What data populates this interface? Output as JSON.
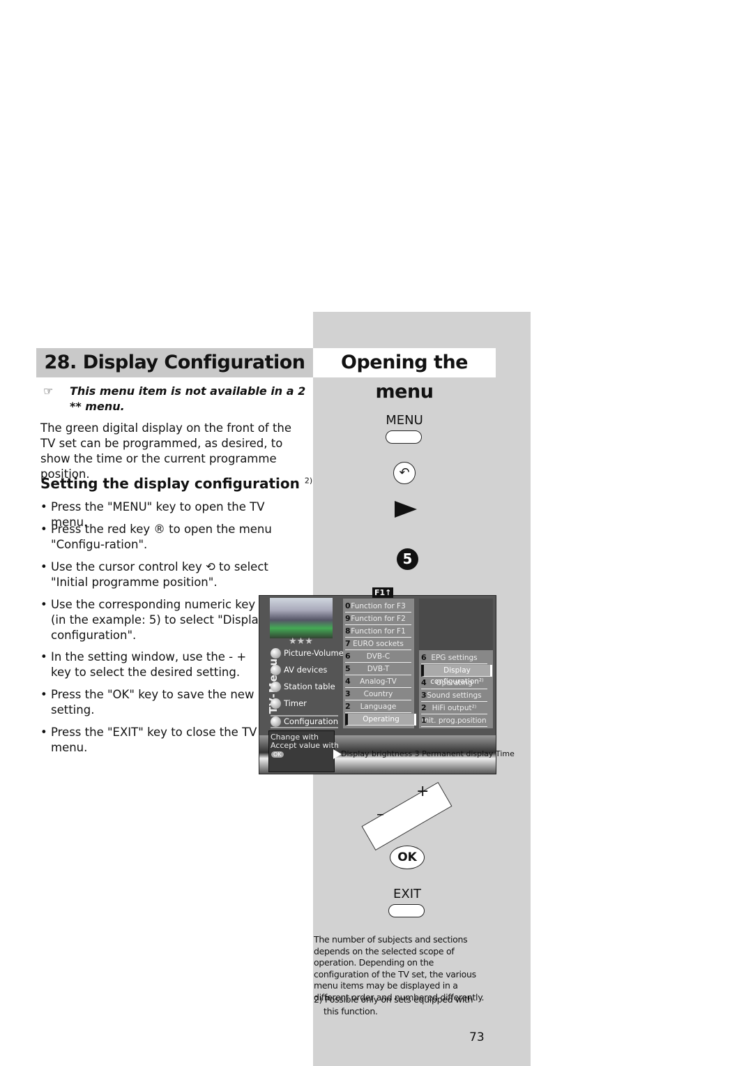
{
  "header": {
    "section_title": "28. Display Configuration",
    "side_title": "Opening the menu"
  },
  "note": {
    "icon": "pointing-hand-icon",
    "text": "This menu item is not available in a 2 ** menu."
  },
  "intro": "The green digital display on the front of the TV set can be programmed, as desired, to show the time or the current programme position.",
  "subheading": {
    "text": "Setting the display configuration",
    "footnote_ref": "2)"
  },
  "steps": [
    "• Press the \"MENU\" key to open the TV menu.",
    "• Press the red key ® to open the menu \"Configu-ration\".",
    "• Use the cursor control key ⟲ to select \"Initial programme position\".",
    "• Use the corresponding numeric key (in the example: 5) to select \"Display configuration\".",
    "• In the setting window, use the - + key to select the desired setting.",
    "• Press the \"OK\" key to save the new setting.",
    "• Press the \"EXIT\" key to close the TV menu."
  ],
  "keys": {
    "menu": "MENU",
    "five": "5",
    "plus": "+",
    "minus": "–",
    "ok": "OK",
    "exit": "EXIT"
  },
  "tv_menu": {
    "f1_label": "F1↑",
    "stars": "★★★",
    "side_label": "TV-Menu",
    "main_items": [
      "Picture-Volume",
      "AV devices",
      "Station table",
      "Timer",
      "Configuration"
    ],
    "middle": [
      {
        "n": "0",
        "label": "Function for F3"
      },
      {
        "n": "9",
        "label": "Function for F2"
      },
      {
        "n": "8",
        "label": "Function for F1"
      },
      {
        "n": "7",
        "label": "EURO sockets"
      },
      {
        "n": "6",
        "label": "DVB-C"
      },
      {
        "n": "5",
        "label": "DVB-T"
      },
      {
        "n": "4",
        "label": "Analog-TV"
      },
      {
        "n": "3",
        "label": "Country"
      },
      {
        "n": "2",
        "label": "Language"
      },
      {
        "n": "",
        "label": "Operating"
      }
    ],
    "right": [
      {
        "n": "6",
        "label": "EPG settings"
      },
      {
        "n": "",
        "label": "Display configuration²⁾"
      },
      {
        "n": "4",
        "label": "Operating"
      },
      {
        "n": "3",
        "label": "Sound settings"
      },
      {
        "n": "2",
        "label": "HiFi output²⁾"
      },
      {
        "n": "1",
        "label": "Init. prog.position"
      }
    ],
    "help_change": "Change with",
    "help_accept": "Accept value with",
    "help_ok": "OK",
    "status": "Display brightness  3   Permanent display  Time"
  },
  "footnote_main": "The number of subjects and sections depends on the selected scope of operation. Depending on the configuration of the TV set, the various menu items may be displayed in a different order and numbered differently.",
  "footnote_2": "2) Possible only on sets equipped with this function.",
  "page_number": "73"
}
